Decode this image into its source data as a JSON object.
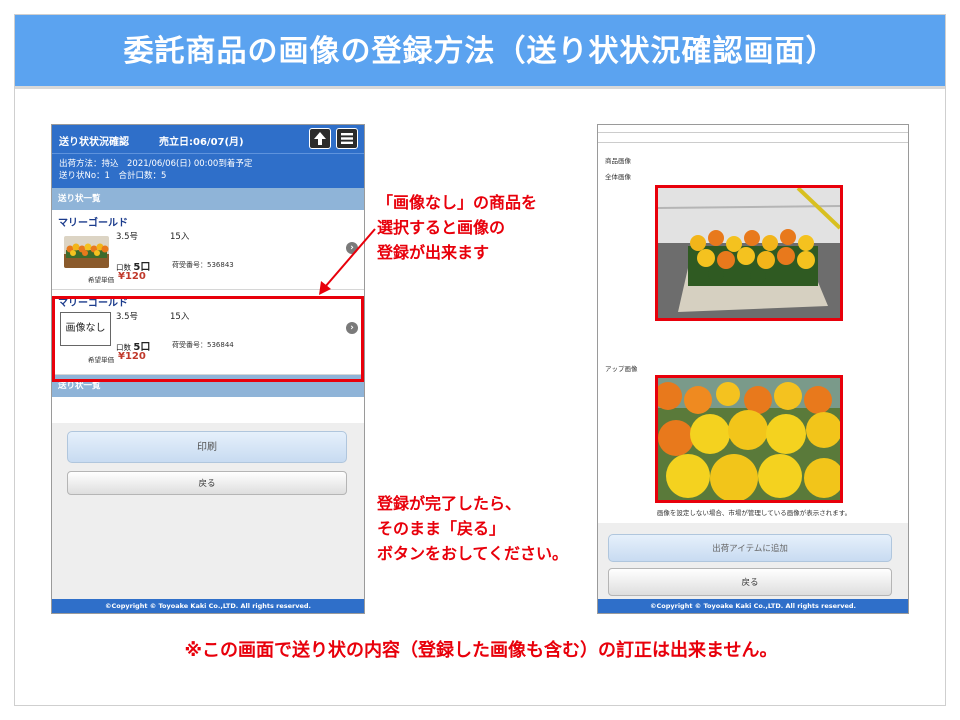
{
  "slide": {
    "title": "委託商品の画像の登録方法（送り状状況確認画面）",
    "annotation_1": [
      "「画像なし」の商品を",
      "選択すると画像の",
      "登録が出来ます"
    ],
    "annotation_2": [
      "登録が完了したら、",
      "そのまま「戻る」",
      "ボタンをおしてください。"
    ],
    "bottom_note": "※この画面で送り状の内容（登録した画像も含む）の訂正は出来ません。",
    "colors": {
      "title_bg": "#5ba3f0",
      "accent_red": "#e8000b",
      "header_blue": "#2f6fc9"
    }
  },
  "left_screen": {
    "header": {
      "title": "送り状状況確認",
      "sale_date": "売立日:06/07(月)",
      "icons": [
        "upload-icon",
        "menu-icon"
      ]
    },
    "info": {
      "line1": "出荷方法：持込　2021/06/06(日) 00:00到着予定",
      "line2": "送り状No：1　合計口数：5"
    },
    "section_label": "送り状一覧",
    "items": [
      {
        "name": "マリーゴールド",
        "size": "3.5号",
        "qty": "15入",
        "units_label": "口数",
        "units_value": "5口",
        "receive_label": "荷受番号：",
        "receive_no": "536843",
        "price_label": "希望単価",
        "price": "¥120",
        "has_image": true
      },
      {
        "name": "マリーゴールド",
        "size": "3.5号",
        "qty": "15入",
        "units_label": "口数",
        "units_value": "5口",
        "receive_label": "荷受番号：",
        "receive_no": "536844",
        "price_label": "希望単価",
        "price": "¥120",
        "has_image": false,
        "no_image_label": "画像なし"
      }
    ],
    "section_label_2": "送り状一覧",
    "print_button": "印刷",
    "back_button": "戻る",
    "footer": "©Copyright © Toyoake Kaki Co.,LTD. All rights reserved."
  },
  "right_screen": {
    "product_image_label": "商品画像",
    "full_image_label": "全体画像",
    "closeup_image_label": "アップ画像",
    "note": "画像を設定しない場合、市場が管理している画像が表示されます。",
    "add_button": "出荷アイテムに追加",
    "back_button": "戻る",
    "footer": "©Copyright © Toyoake Kaki Co.,LTD. All rights reserved."
  }
}
